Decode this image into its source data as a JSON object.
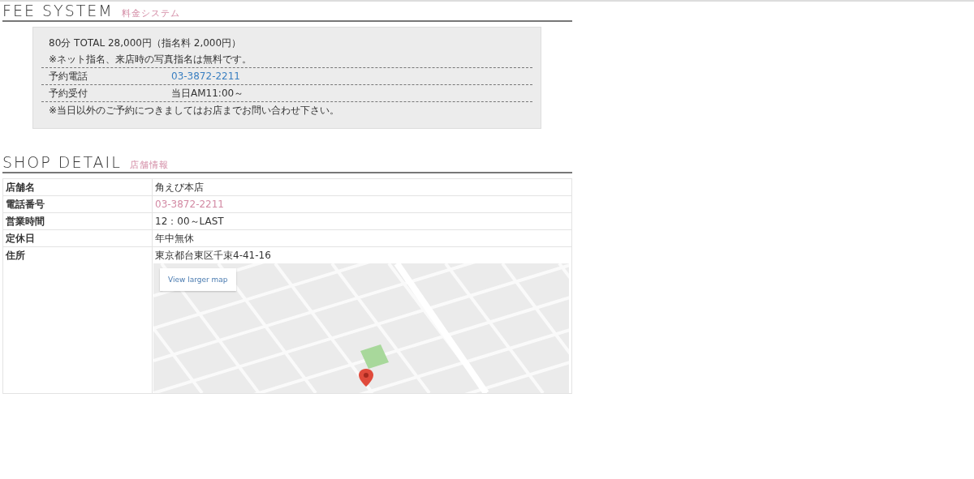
{
  "fee_section": {
    "title": "FEE SYSTEM",
    "subtitle": "料金システム",
    "notes_top": [
      "80分 TOTAL 28,000円（指名料 2,000円）",
      "※ネット指名、来店時の写真指名は無料です。"
    ],
    "rows": [
      {
        "label": "予約電話",
        "value": "03-3872-2211",
        "kind": "link"
      },
      {
        "label": "予約受付",
        "value": "当日AM11:00～",
        "kind": "text"
      }
    ],
    "notes_bottom": [
      "※当日以外のご予約につきましてはお店までお問い合わせ下さい。"
    ]
  },
  "shop_section": {
    "title": "SHOP DETAIL",
    "subtitle": "店舗情報",
    "rows": [
      {
        "label": "店舗名",
        "value": "角えび本店",
        "kind": "text"
      },
      {
        "label": "電話番号",
        "value": "03-3872-2211",
        "kind": "link"
      },
      {
        "label": "営業時間",
        "value": "12：00～LAST",
        "kind": "text"
      },
      {
        "label": "定休日",
        "value": "年中無休",
        "kind": "text"
      },
      {
        "label": "住所",
        "value": "東京都台東区千束4-41-16",
        "kind": "map"
      }
    ],
    "map": {
      "link": "View larger map"
    }
  }
}
